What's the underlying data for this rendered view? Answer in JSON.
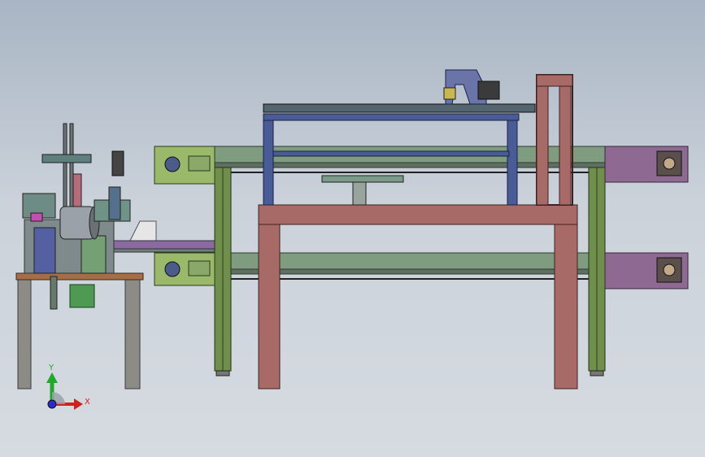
{
  "viewport": {
    "background_top": "#a9b5c4",
    "background_bottom": "#d6dbe1"
  },
  "colors": {
    "frame_steel": "#5f7a6a",
    "rail_green": "#7f9b80",
    "leg_green": "#6f8f4a",
    "gantry_blue": "#4a5c98",
    "table_red": "#a86a67",
    "motor_box_purple": "#8e6a93",
    "control_panel_green": "#9bb96b",
    "machine_gray": "#8e8e8e"
  },
  "triad": {
    "x_label": "X",
    "y_label": "Y",
    "x_color": "#d22020",
    "y_color": "#1fa82a",
    "origin_color": "#2a2ad0"
  }
}
